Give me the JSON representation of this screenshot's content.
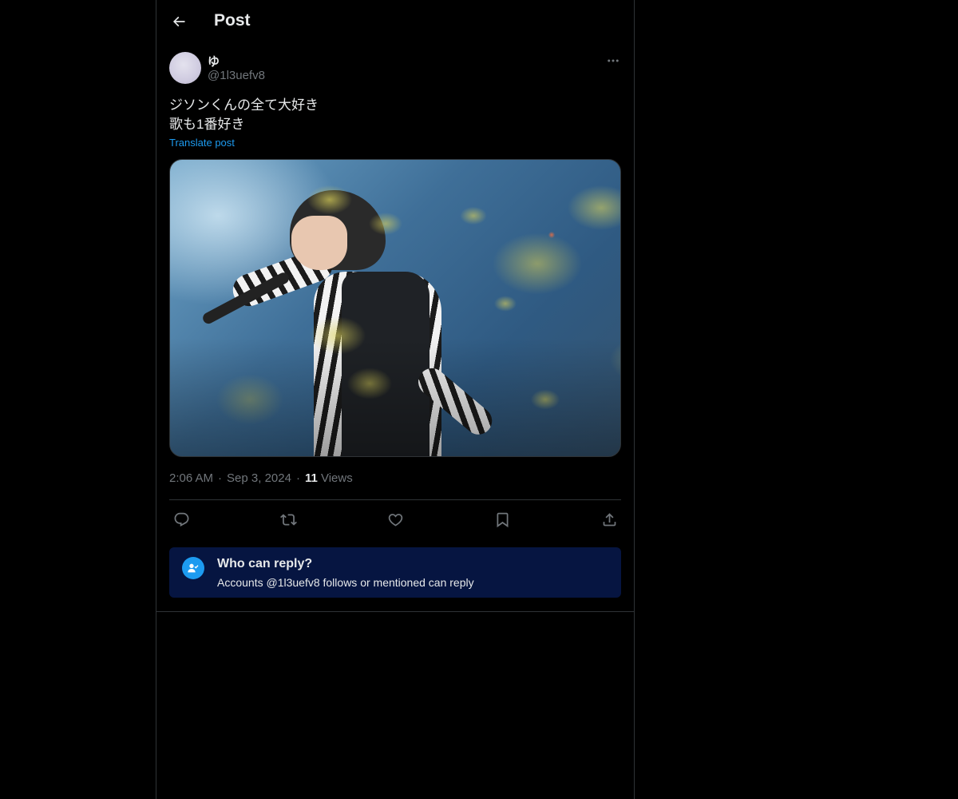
{
  "header": {
    "title": "Post"
  },
  "author": {
    "display_name": "ゆ",
    "handle": "@1l3uefv8"
  },
  "post": {
    "lines": [
      "ジソンくんの全て大好き",
      "歌も1番好き"
    ],
    "translate_label": "Translate post",
    "time": "2:06 AM",
    "date": "Sep 3, 2024",
    "views_count": "11",
    "views_label": "Views",
    "separator": "·"
  },
  "actions": [
    {
      "name": "reply",
      "icon": "reply-icon"
    },
    {
      "name": "repost",
      "icon": "repost-icon"
    },
    {
      "name": "like",
      "icon": "heart-icon"
    },
    {
      "name": "bookmark",
      "icon": "bookmark-icon"
    },
    {
      "name": "share",
      "icon": "share-icon"
    }
  ],
  "reply_settings": {
    "title": "Who can reply?",
    "subtitle": "Accounts @1l3uefv8 follows or mentioned can reply"
  },
  "colors": {
    "background": "#000000",
    "accent": "#1d9bf0",
    "muted_text": "#71767b",
    "reply_box": "#061541"
  }
}
